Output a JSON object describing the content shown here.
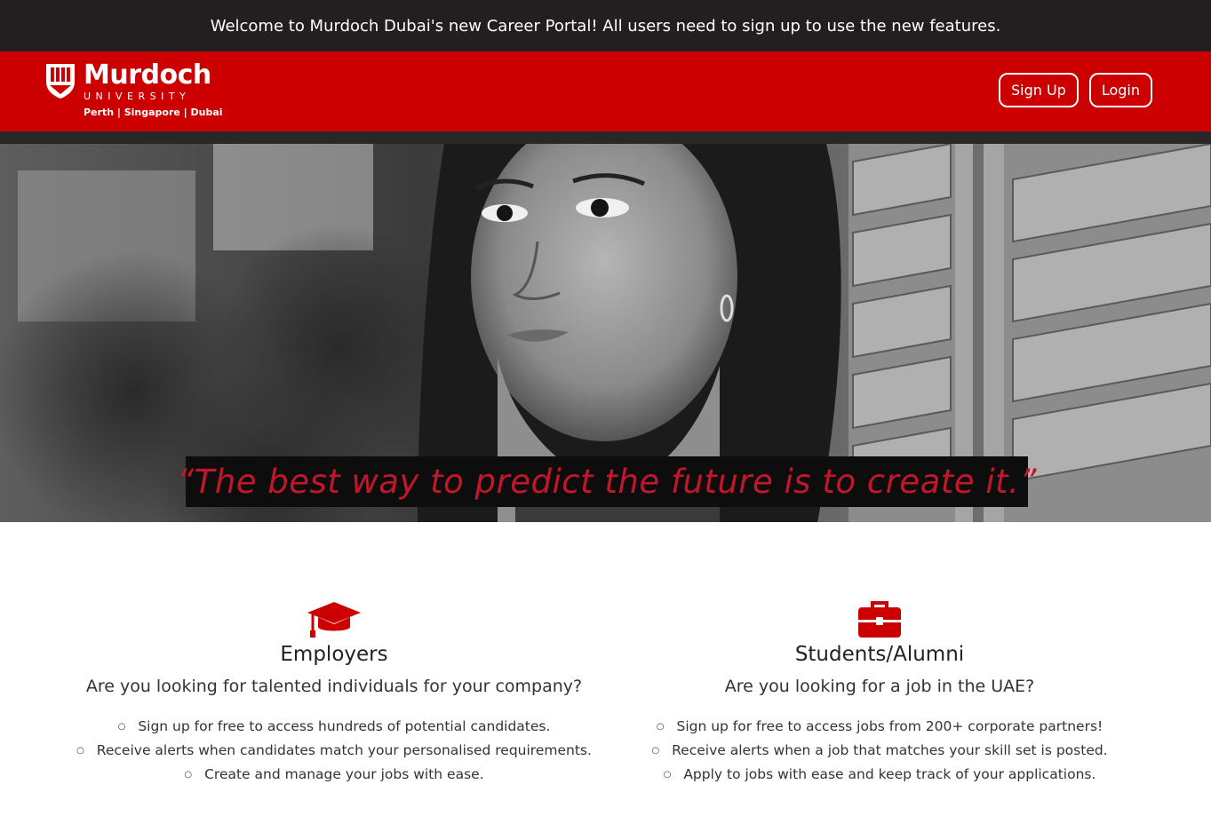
{
  "announcement": "Welcome to Murdoch Dubai's new Career Portal! All users need to sign up to use the new features.",
  "header": {
    "logo": {
      "name": "Murdoch",
      "subtitle": "UNIVERSITY",
      "campuses": "Perth | Singapore | Dubai"
    },
    "nav": {
      "signup_label": "Sign Up",
      "login_label": "Login"
    }
  },
  "hero": {
    "quote": "“The best way to predict the future is to create it.”"
  },
  "colors": {
    "brand_red": "#cc0000",
    "dark": "#231f20",
    "quote_red": "#c2172a"
  },
  "features": {
    "employers": {
      "icon": "graduation-cap-icon",
      "title": "Employers",
      "question": "Are you looking for talented individuals for your company?",
      "points": [
        "Sign up for free to access hundreds of potential candidates.",
        "Receive alerts when candidates match your personalised requirements.",
        "Create and manage your jobs with ease."
      ]
    },
    "students": {
      "icon": "briefcase-icon",
      "title": "Students/Alumni",
      "question": "Are you looking for a job in the UAE?",
      "points": [
        "Sign up for free to access jobs from 200+ corporate partners!",
        "Receive alerts when a job that matches your skill set is posted.",
        "Apply to jobs with ease and keep track of your applications."
      ]
    }
  }
}
